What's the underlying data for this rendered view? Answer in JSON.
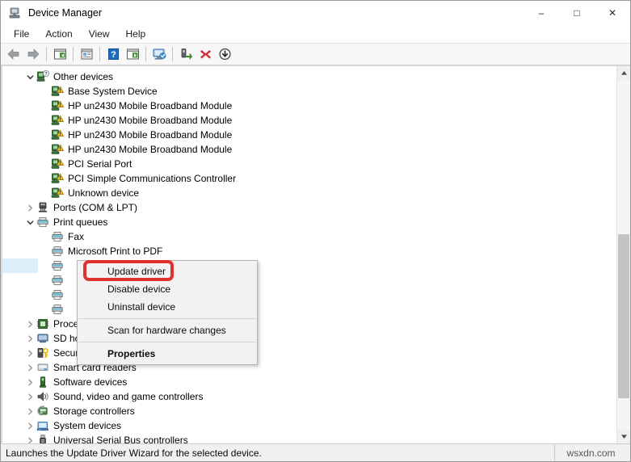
{
  "window": {
    "title": "Device Manager",
    "icon": "device-manager-icon",
    "controls": {
      "minimize": "–",
      "maximize": "□",
      "close": "✕"
    }
  },
  "menubar": {
    "items": [
      {
        "label": "File"
      },
      {
        "label": "Action"
      },
      {
        "label": "View"
      },
      {
        "label": "Help"
      }
    ]
  },
  "toolbar": {
    "buttons": [
      {
        "name": "back-icon",
        "tip": "Back"
      },
      {
        "name": "forward-icon",
        "tip": "Forward"
      },
      {
        "name": "separator",
        "tip": ""
      },
      {
        "name": "show-hide-console-tree-icon",
        "tip": "Show/Hide Console Tree"
      },
      {
        "name": "separator",
        "tip": ""
      },
      {
        "name": "properties-icon",
        "tip": "Properties"
      },
      {
        "name": "separator",
        "tip": ""
      },
      {
        "name": "help-icon",
        "tip": "Help"
      },
      {
        "name": "show-hide-action-pane-icon",
        "tip": "Show/Hide Action Pane"
      },
      {
        "name": "separator",
        "tip": ""
      },
      {
        "name": "scan-for-hardware-changes-icon",
        "tip": "Scan for hardware changes"
      },
      {
        "name": "separator",
        "tip": ""
      },
      {
        "name": "update-driver-icon",
        "tip": "Update driver"
      },
      {
        "name": "uninstall-device-icon",
        "tip": "Uninstall device"
      },
      {
        "name": "disable-device-icon",
        "tip": "Disable device"
      }
    ]
  },
  "tree": {
    "rows": [
      {
        "label": "Other devices",
        "level": 1,
        "expander": "expanded",
        "icon": "unknown-device-icon",
        "selected": false
      },
      {
        "label": "Base System Device",
        "level": 2,
        "expander": "none",
        "icon": "warning-device-icon",
        "selected": false
      },
      {
        "label": "HP un2430 Mobile Broadband Module",
        "level": 2,
        "expander": "none",
        "icon": "warning-device-icon",
        "selected": false
      },
      {
        "label": "HP un2430 Mobile Broadband Module",
        "level": 2,
        "expander": "none",
        "icon": "warning-device-icon",
        "selected": false
      },
      {
        "label": "HP un2430 Mobile Broadband Module",
        "level": 2,
        "expander": "none",
        "icon": "warning-device-icon",
        "selected": false
      },
      {
        "label": "HP un2430 Mobile Broadband Module",
        "level": 2,
        "expander": "none",
        "icon": "warning-device-icon",
        "selected": false
      },
      {
        "label": "PCI Serial Port",
        "level": 2,
        "expander": "none",
        "icon": "warning-device-icon",
        "selected": false
      },
      {
        "label": "PCI Simple Communications Controller",
        "level": 2,
        "expander": "none",
        "icon": "warning-device-icon",
        "selected": false
      },
      {
        "label": "Unknown device",
        "level": 2,
        "expander": "none",
        "icon": "warning-device-icon",
        "selected": false
      },
      {
        "label": "Ports (COM & LPT)",
        "level": 1,
        "expander": "collapsed",
        "icon": "port-icon",
        "selected": false
      },
      {
        "label": "Print queues",
        "level": 1,
        "expander": "expanded",
        "icon": "printer-icon",
        "selected": false
      },
      {
        "label": "Fax",
        "level": 2,
        "expander": "none",
        "icon": "printer-icon",
        "selected": false
      },
      {
        "label": "Microsoft Print to PDF",
        "level": 2,
        "expander": "none",
        "icon": "printer-icon",
        "selected": false
      },
      {
        "label": "",
        "level": 2,
        "expander": "none",
        "icon": "printer-icon",
        "selected": true
      },
      {
        "label": "",
        "level": 2,
        "expander": "none",
        "icon": "printer-icon",
        "selected": false
      },
      {
        "label": "",
        "level": 2,
        "expander": "none",
        "icon": "printer-icon",
        "selected": false
      },
      {
        "label": "",
        "level": 2,
        "expander": "none",
        "icon": "printer-icon",
        "selected": false
      },
      {
        "label": "Processors",
        "level": 1,
        "expander": "collapsed",
        "icon": "processor-icon",
        "selected": false
      },
      {
        "label": "SD host adapters",
        "level": 1,
        "expander": "collapsed",
        "icon": "sd-host-icon",
        "selected": false
      },
      {
        "label": "Security devices",
        "level": 1,
        "expander": "collapsed",
        "icon": "security-device-icon",
        "selected": false
      },
      {
        "label": "Smart card readers",
        "level": 1,
        "expander": "collapsed",
        "icon": "smart-card-reader-icon",
        "selected": false
      },
      {
        "label": "Software devices",
        "level": 1,
        "expander": "collapsed",
        "icon": "software-device-icon",
        "selected": false
      },
      {
        "label": "Sound, video and game controllers",
        "level": 1,
        "expander": "collapsed",
        "icon": "sound-device-icon",
        "selected": false
      },
      {
        "label": "Storage controllers",
        "level": 1,
        "expander": "collapsed",
        "icon": "storage-controller-icon",
        "selected": false
      },
      {
        "label": "System devices",
        "level": 1,
        "expander": "collapsed",
        "icon": "system-device-icon",
        "selected": false
      },
      {
        "label": "Universal Serial Bus controllers",
        "level": 1,
        "expander": "collapsed",
        "icon": "usb-controller-icon",
        "selected": false
      }
    ]
  },
  "context_menu": {
    "items": [
      {
        "label": "Update driver",
        "bold": false,
        "separator_after": false,
        "highlighted": true
      },
      {
        "label": "Disable device",
        "bold": false,
        "separator_after": false,
        "highlighted": false
      },
      {
        "label": "Uninstall device",
        "bold": false,
        "separator_after": true,
        "highlighted": false
      },
      {
        "label": "Scan for hardware changes",
        "bold": false,
        "separator_after": true,
        "highlighted": false
      },
      {
        "label": "Properties",
        "bold": true,
        "separator_after": false,
        "highlighted": false
      }
    ]
  },
  "statusbar": {
    "text": "Launches the Update Driver Wizard for the selected device.",
    "watermark": "wsxdn.com"
  },
  "colors": {
    "highlight_red": "#e03131",
    "selection_blue": "#ddeefb",
    "toolbar_bg": "#f7f7f7",
    "menu_bg": "#f2f2f2",
    "statusbar_bg": "#f0f0f0"
  },
  "scrollbar": {
    "up_arrow": "▲",
    "down_arrow": "▼",
    "thumb_top_pct": 44,
    "thumb_height_pct": 47
  }
}
